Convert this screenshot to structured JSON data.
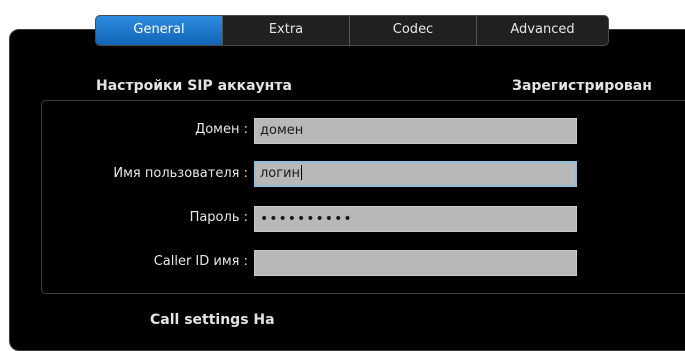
{
  "tabs": [
    {
      "label": "General",
      "active": true
    },
    {
      "label": "Extra",
      "active": false
    },
    {
      "label": "Codec",
      "active": false
    },
    {
      "label": "Advanced",
      "active": false
    }
  ],
  "section": {
    "title": "Настройки SIP аккаунта",
    "status": "Зарегистрирован"
  },
  "form": {
    "domain": {
      "label": "Домен :",
      "value": "домен"
    },
    "username": {
      "label": "Имя пользователя :",
      "value": "логин"
    },
    "password": {
      "label": "Пароль :",
      "value": "••••••••••"
    },
    "callerid": {
      "label": "Caller ID имя :",
      "value": ""
    }
  },
  "bottom": {
    "partial_text": "Call settings Ha"
  },
  "colors": {
    "active_tab": "#1a78d0",
    "field_bg": "#b8b8b8",
    "focus_border": "#8fbedf",
    "panel_bg": "#000000"
  }
}
